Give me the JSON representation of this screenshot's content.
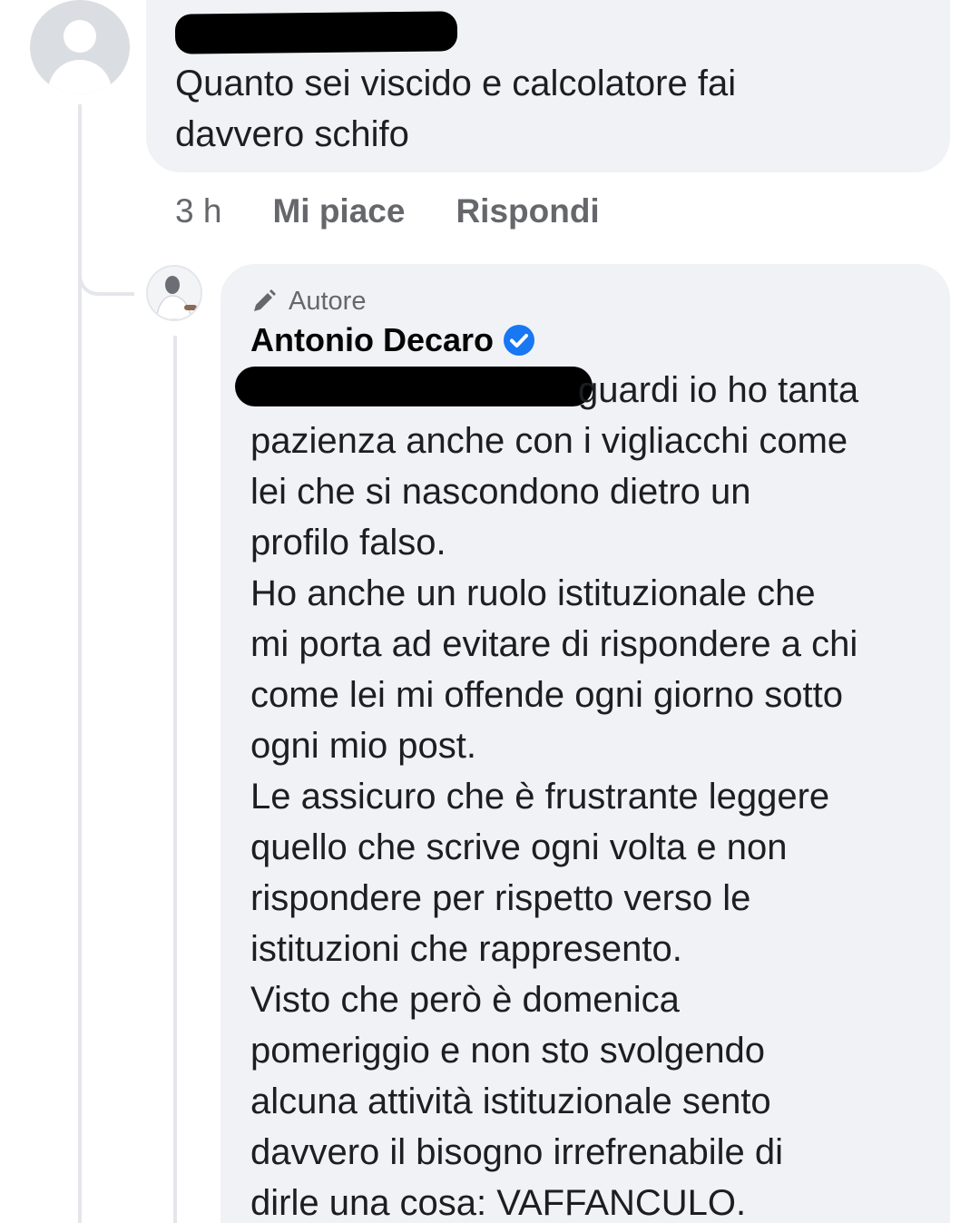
{
  "top_comment": {
    "avatar_icon": "default-user-icon",
    "author_redacted": true,
    "text": "Quanto sei viscido e calcolatore fai\ndavvero schifo"
  },
  "actions": {
    "time": "3 h",
    "like_label": "Mi piace",
    "reply_label": "Rispondi"
  },
  "reply": {
    "badge_icon": "pen-icon",
    "badge_label": "Autore",
    "author": "Antonio Decaro",
    "verified_icon": "verified-badge-icon",
    "mention_redacted": true,
    "first_line": "guardi io ho tanta",
    "body": "pazienza anche con i vigliacchi come\nlei che si nascondono dietro un\nprofilo falso.\nHo anche un ruolo istituzionale che\nmi porta ad evitare di rispondere a chi\ncome lei mi offende ogni giorno sotto\nogni mio post.\nLe assicuro che è frustrante leggere\nquello che scrive ogni volta e non\nrispondere per rispetto verso le\nistituzioni che rappresento.\nVisto che però è domenica\npomeriggio e non sto svolgendo\nalcuna attività istituzionale sento\ndavvero il bisogno irrefrenabile di\ndirle una cosa: VAFFANCULO."
  },
  "colors": {
    "bubble": "#f0f2f5",
    "secondary_text": "#65676b",
    "verified_blue": "#1877f2",
    "thread_line": "#e4e6eb"
  }
}
